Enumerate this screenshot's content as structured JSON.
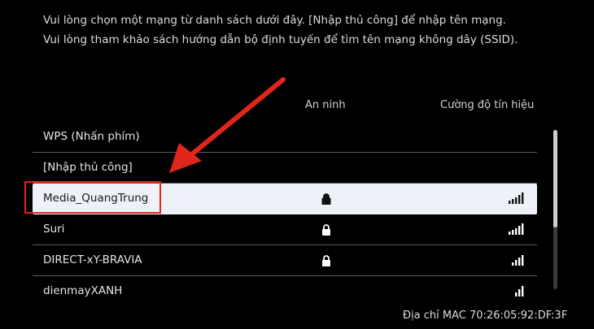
{
  "instructions": {
    "line1": "Vui lòng chọn một mạng từ danh sách dưới đây. [Nhập thủ công] để nhập tên mạng.",
    "line2": "Vui lòng tham khảo sách hướng dẫn bộ định tuyến để tìm tên mạng không dây (SSID)."
  },
  "columns": {
    "security": "An ninh",
    "signal": "Cường độ tín hiệu"
  },
  "networks": [
    {
      "name": "WPS (Nhấn phím)",
      "secured": false,
      "signal_bars": 0,
      "selected": false
    },
    {
      "name": "[Nhập thủ công]",
      "secured": false,
      "signal_bars": 0,
      "selected": false
    },
    {
      "name": "Media_QuangTrung",
      "secured": true,
      "signal_bars": 5,
      "selected": true
    },
    {
      "name": "Suri",
      "secured": true,
      "signal_bars": 5,
      "selected": false
    },
    {
      "name": "DIRECT-xY-BRAVIA",
      "secured": true,
      "signal_bars": 4,
      "selected": false
    },
    {
      "name": "dienmayXANH",
      "secured": false,
      "signal_bars": 3,
      "selected": false
    }
  ],
  "mac_address": "Địa chỉ MAC 70:26:05:92:DF:3F",
  "icons": {
    "lock": "lock-icon",
    "signal": "signal-strength-icon"
  },
  "colors": {
    "background": "#000000",
    "selected_row": "#eef1f7",
    "annotation_red": "#e0261a"
  }
}
